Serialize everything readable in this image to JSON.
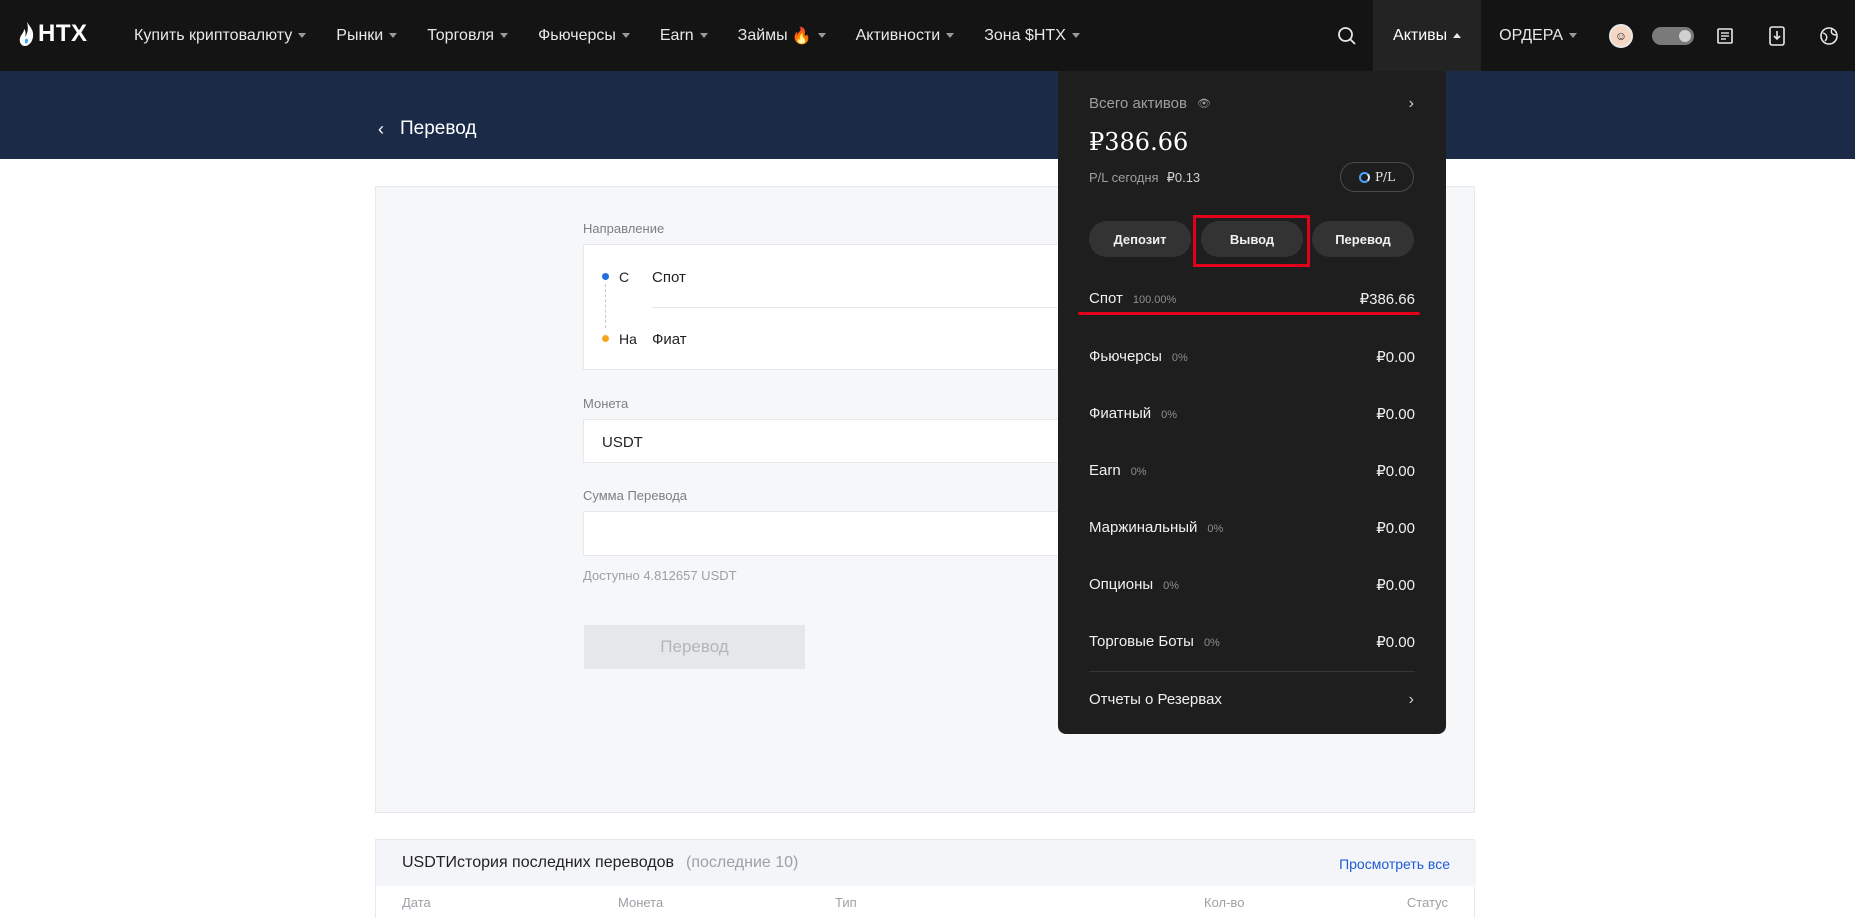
{
  "nav": {
    "logo": "HTX",
    "items": [
      {
        "label": "Купить криптовалюту"
      },
      {
        "label": "Рынки"
      },
      {
        "label": "Торговля"
      },
      {
        "label": "Фьючерсы"
      },
      {
        "label": "Earn"
      },
      {
        "label": "Займы",
        "icon": "fire-icon"
      },
      {
        "label": "Активности"
      },
      {
        "label": "Зона $HTX"
      }
    ],
    "assets_label": "Активы",
    "orders_label": "ОРДЕРА"
  },
  "page": {
    "title": "Перевод"
  },
  "form": {
    "direction_label": "Направление",
    "from_label": "С",
    "from_value": "Спот",
    "to_label": "На",
    "to_value": "Фиат",
    "coin_label": "Монета",
    "coin_value": "USDT",
    "amount_label": "Сумма Перевода",
    "amount_value": "",
    "available": "Доступно 4.812657 USDT",
    "submit_label": "Перевод"
  },
  "history": {
    "title": "USDTИстория последних переводов",
    "subtitle": "(последние 10)",
    "view_all": "Просмотреть все",
    "columns": [
      "Дата",
      "Монета",
      "Тип",
      "Кол-во",
      "Статус"
    ]
  },
  "assets_dropdown": {
    "total_label": "Всего активов",
    "total_value": "₽386.66",
    "pl_label": "P/L сегодня",
    "pl_value": "₽0.13",
    "pl_button": "P/L",
    "buttons": {
      "deposit": "Депозит",
      "withdraw": "Вывод",
      "transfer": "Перевод"
    },
    "accounts": [
      {
        "name": "Спот",
        "pct": "100.00%",
        "amount": "₽386.66"
      },
      {
        "name": "Фьючерсы",
        "pct": "0%",
        "amount": "₽0.00"
      },
      {
        "name": "Фиатный",
        "pct": "0%",
        "amount": "₽0.00"
      },
      {
        "name": "Earn",
        "pct": "0%",
        "amount": "₽0.00"
      },
      {
        "name": "Маржинальный",
        "pct": "0%",
        "amount": "₽0.00"
      },
      {
        "name": "Опционы",
        "pct": "0%",
        "amount": "₽0.00"
      },
      {
        "name": "Торговые Боты",
        "pct": "0%",
        "amount": "₽0.00"
      }
    ],
    "reserves_label": "Отчеты о Резервах"
  },
  "colors": {
    "nav_bg": "#141414",
    "banner_bg": "#1b2a47",
    "dropdown_bg": "#1e1e1e",
    "highlight": "#e3001b",
    "from_dot": "#1f6fe0",
    "to_dot": "#f5a623",
    "link": "#1f5bd8"
  }
}
